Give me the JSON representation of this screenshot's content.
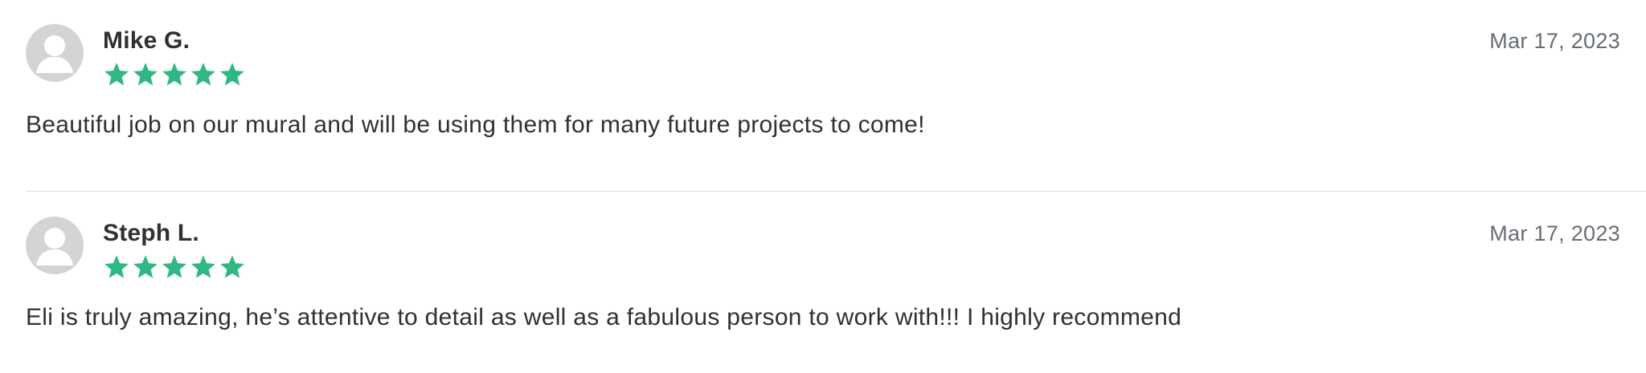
{
  "colors": {
    "star": "#2fb883",
    "avatar": "#d3d4d6",
    "text": "#2f3033",
    "date": "#676d73",
    "divider": "#dcdde0"
  },
  "reviews": [
    {
      "name": "Mike G.",
      "date": "Mar 17, 2023",
      "rating": 5,
      "text": "Beautiful job on our mural and will be using them for many future projects to come!"
    },
    {
      "name": "Steph L.",
      "date": "Mar 17, 2023",
      "rating": 5,
      "text": "Eli is truly amazing, he’s attentive to detail as well as a fabulous person to work with!!! I highly recommend"
    }
  ]
}
